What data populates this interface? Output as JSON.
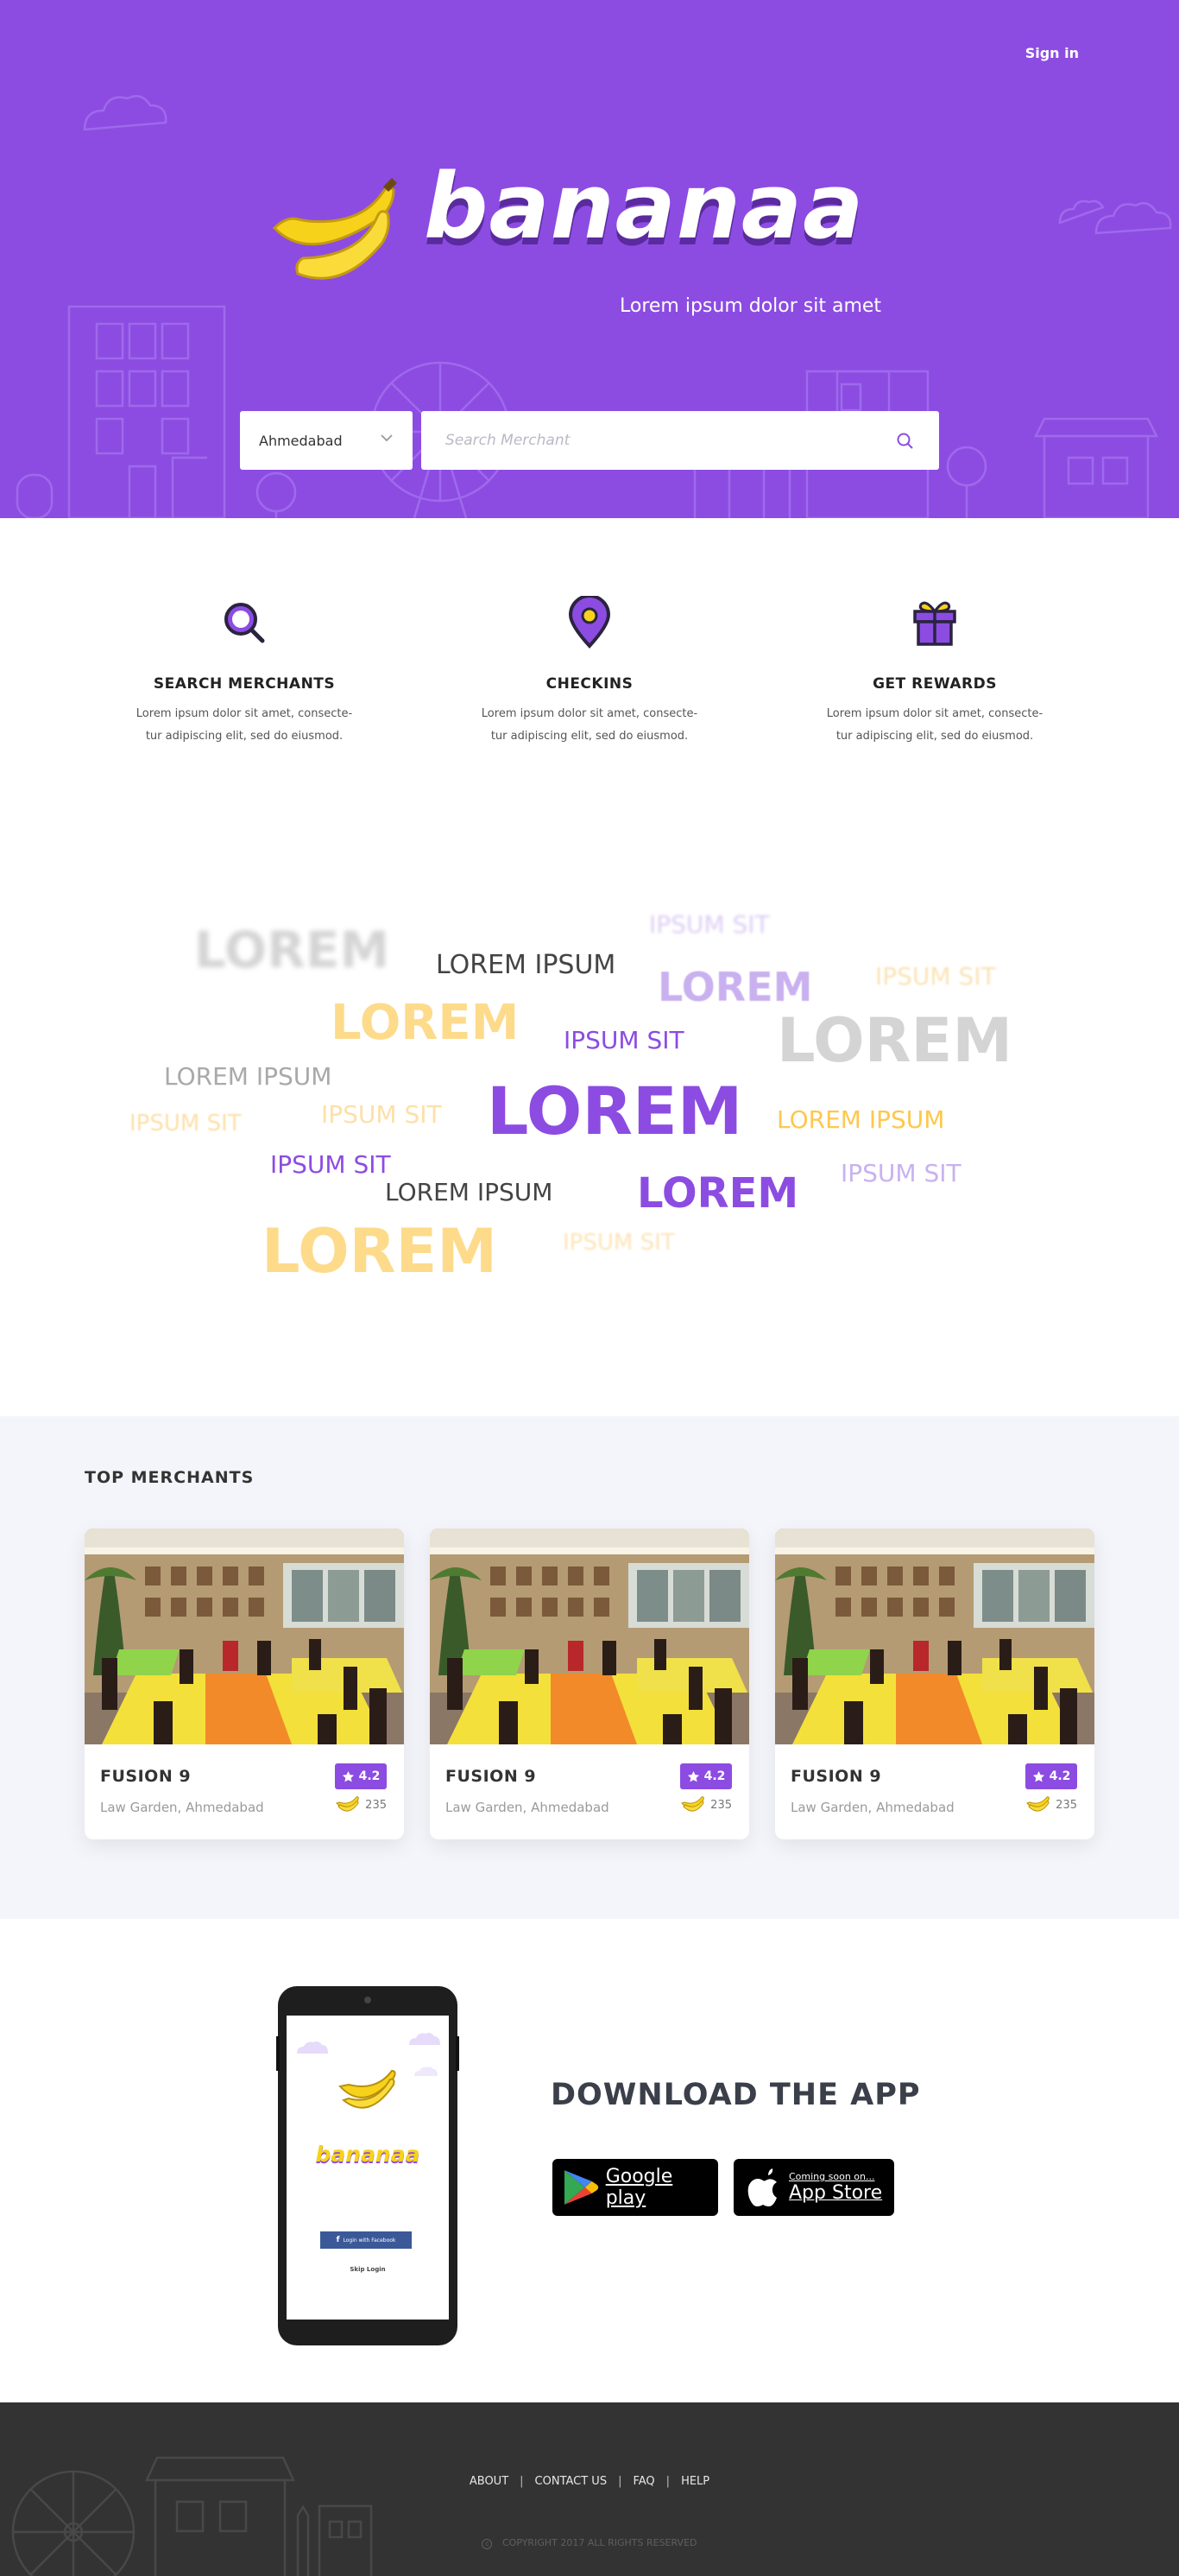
{
  "header": {
    "signin_label": "Sign in",
    "brand": "bananaa",
    "tagline": "Lorem ipsum dolor sit amet"
  },
  "search": {
    "city": "Ahmedabad",
    "placeholder": "Search Merchant"
  },
  "features": [
    {
      "icon": "search-icon",
      "title": "SEARCH MERCHANTS",
      "line1": "Lorem ipsum dolor sit amet, consecte-",
      "line2": "tur adipiscing elit, sed do eiusmod."
    },
    {
      "icon": "map-pin-icon",
      "title": "CHECKINS",
      "line1": "Lorem ipsum dolor sit amet, consecte-",
      "line2": "tur adipiscing elit, sed do eiusmod."
    },
    {
      "icon": "gift-icon",
      "title": "GET REWARDS",
      "line1": "Lorem ipsum dolor sit amet, consecte-",
      "line2": "tur adipiscing elit, sed do eiusmod."
    }
  ],
  "word_cloud": [
    "LOREM",
    "IPSUM SIT",
    "LOREM IPSUM",
    "LOREM",
    "IPSUM SIT",
    "LOREM",
    "IPSUM SIT",
    "LOREM",
    "LOREM IPSUM",
    "IPSUM SIT",
    "IPSUM SIT",
    "LOREM",
    "LOREM IPSUM",
    "IPSUM SIT",
    "LOREM IPSUM",
    "LOREM",
    "IPSUM SIT",
    "LOREM",
    "IPSUM SIT"
  ],
  "merchants": {
    "title": "TOP MERCHANTS",
    "items": [
      {
        "name": "FUSION 9",
        "address": "Law Garden, Ahmedabad",
        "rating": "4.2",
        "count": "235"
      },
      {
        "name": "FUSION 9",
        "address": "Law Garden, Ahmedabad",
        "rating": "4.2",
        "count": "235"
      },
      {
        "name": "FUSION 9",
        "address": "Law Garden, Ahmedabad",
        "rating": "4.2",
        "count": "235"
      }
    ]
  },
  "download": {
    "title": "DOWNLOAD THE APP",
    "phone_brand": "bananaa",
    "phone_fb_label": "Login with Facebook",
    "phone_skip_label": "Skip Login",
    "google_play_label": "Google play",
    "app_store_small": "Coming soon on...",
    "app_store_label": "App Store"
  },
  "footer": {
    "links": [
      "ABOUT",
      "CONTACT US",
      "FAQ",
      "HELP"
    ],
    "copyright": "COPYRIGHT 2017 ALL RIGHTS RESERVED"
  },
  "colors": {
    "brand_purple": "#8c4ce2",
    "banana_yellow": "#f7d21b",
    "footer_bg": "#333333",
    "merchants_bg": "#f4f5fa"
  }
}
